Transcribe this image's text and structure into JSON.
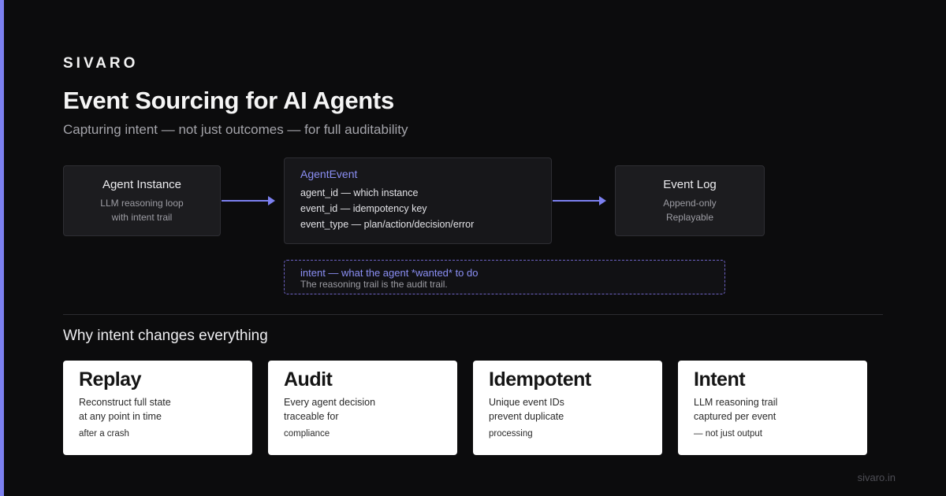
{
  "brand": "SIVARO",
  "title": "Event Sourcing for AI Agents",
  "subtitle": "Capturing intent — not just outcomes — for full auditability",
  "colors": {
    "accent": "#7c80f0",
    "background": "#0c0c0d",
    "card": "#ffffff",
    "intent_border": "#6d62c4"
  },
  "diagram": {
    "agent": {
      "title": "Agent Instance",
      "lines": [
        "LLM reasoning loop",
        "with intent trail"
      ]
    },
    "event": {
      "title": "AgentEvent",
      "fields": [
        {
          "name": "agent_id",
          "desc": "which instance"
        },
        {
          "name": "event_id",
          "desc": "idempotency key"
        },
        {
          "name": "event_type",
          "desc": "plan/action/decision/error"
        }
      ]
    },
    "log": {
      "title": "Event Log",
      "lines": [
        "Append-only",
        "Replayable"
      ]
    },
    "intent": {
      "line": "intent — what the agent *wanted* to do",
      "sub": "The reasoning trail is the audit trail."
    }
  },
  "section_title": "Why intent changes everything",
  "cards": [
    {
      "title": "Replay",
      "lines": [
        "Reconstruct full state",
        "at any point in time"
      ],
      "extra": "after a crash"
    },
    {
      "title": "Audit",
      "lines": [
        "Every agent decision",
        "traceable for"
      ],
      "extra": "compliance"
    },
    {
      "title": "Idempotent",
      "lines": [
        "Unique event IDs",
        "prevent duplicate"
      ],
      "extra": "processing"
    },
    {
      "title": "Intent",
      "lines": [
        "LLM reasoning trail",
        "captured per event"
      ],
      "extra": "— not just output"
    }
  ],
  "footer": "sivaro.in"
}
